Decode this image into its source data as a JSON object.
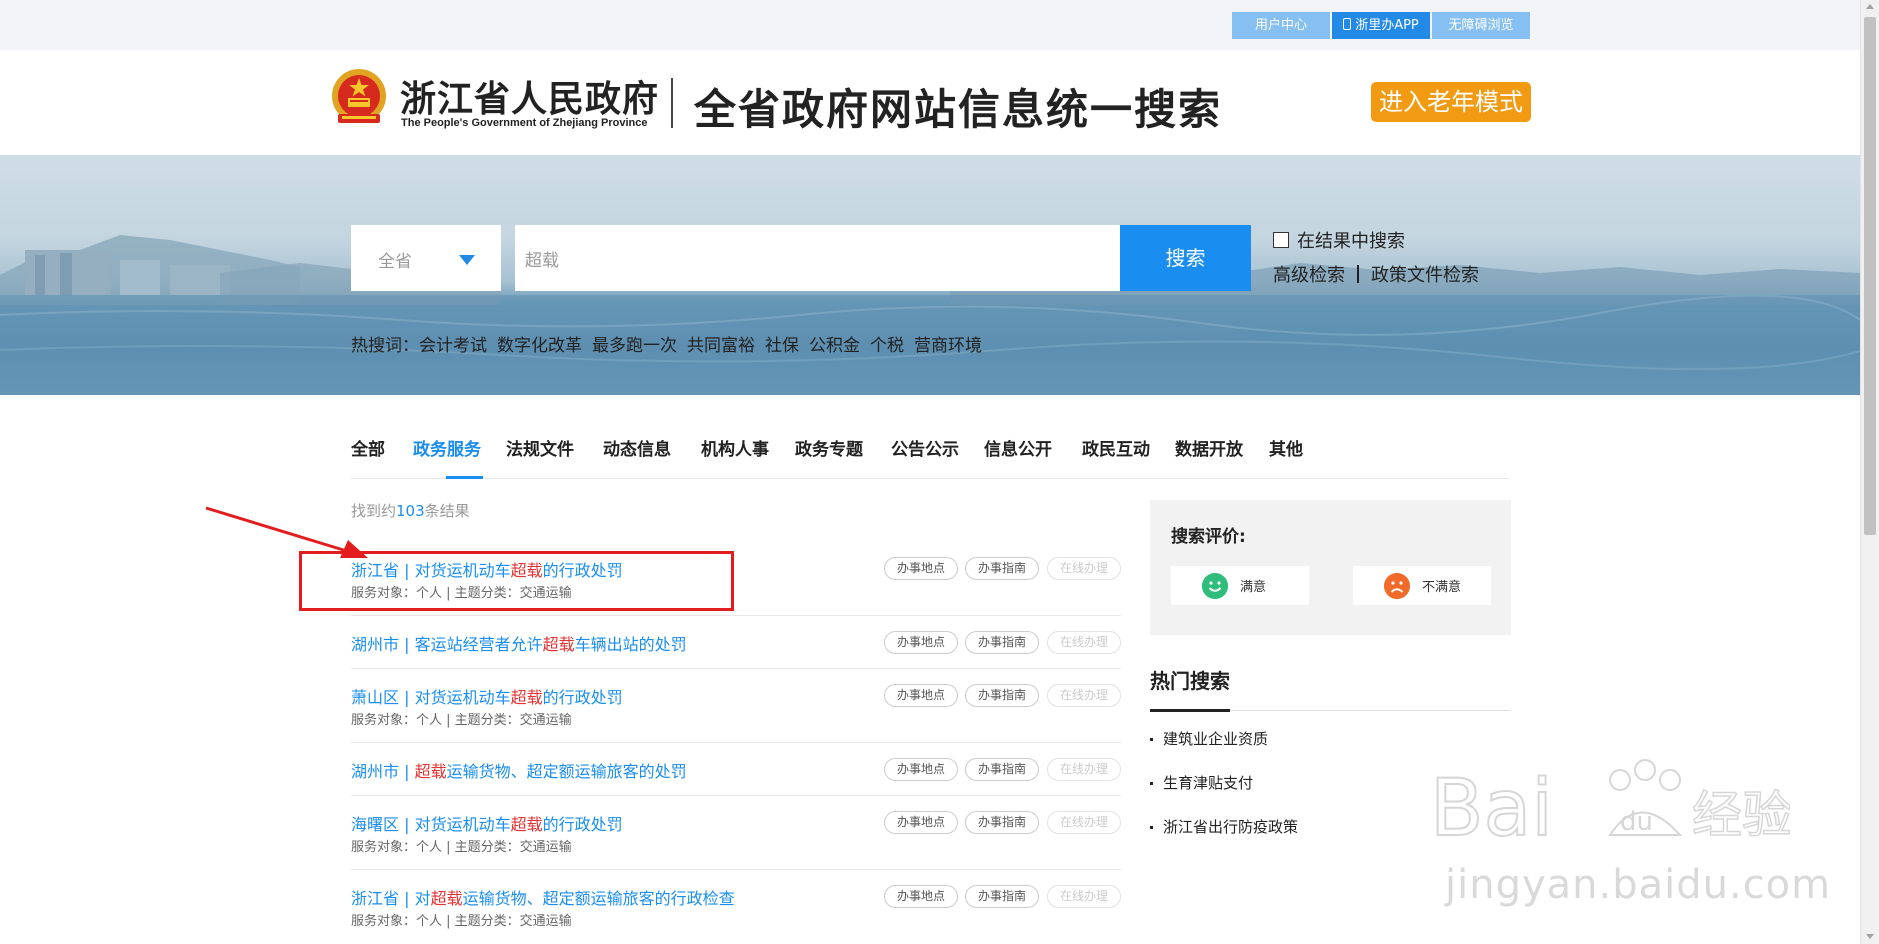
{
  "util_bar": {
    "user_center": "用户中心",
    "app": "浙里办APP",
    "accessible": "无障碍浏览"
  },
  "header": {
    "org_cn": "浙江省人民政府",
    "org_en": "The People's Government of Zhejiang Province",
    "title": "全省政府网站信息统一搜索",
    "elder_mode": "进入老年模式"
  },
  "search": {
    "scope": "全省",
    "query": "超载",
    "button": "搜索",
    "in_results": "在结果中搜索",
    "advanced": "高级检索",
    "policy": "政策文件检索",
    "hot_prefix": "热搜词：",
    "hot_words": [
      "会计考试",
      "数字化改革",
      "最多跑一次",
      "共同富裕",
      "社保",
      "公积金",
      "个税",
      "营商环境"
    ]
  },
  "tabs": [
    "全部",
    "政务服务",
    "法规文件",
    "动态信息",
    "机构人事",
    "政务专题",
    "公告公示",
    "信息公开",
    "政民互动",
    "数据开放",
    "其他"
  ],
  "results": {
    "count_prefix": "找到约",
    "count": "103",
    "count_suffix": "条结果",
    "btn_location": "办事地点",
    "btn_guide": "办事指南",
    "btn_online": "在线办理",
    "items": [
      {
        "pre": "浙江省 | 对货运机动车",
        "hl": "超载",
        "post": "的行政处罚",
        "meta": "服务对象：个人  |  主题分类：交通运输"
      },
      {
        "pre": "湖州市 | 客运站经营者允许",
        "hl": "超载",
        "post": "车辆出站的处罚",
        "meta": ""
      },
      {
        "pre": "萧山区 | 对货运机动车",
        "hl": "超载",
        "post": "的行政处罚",
        "meta": "服务对象：个人  |  主题分类：交通运输"
      },
      {
        "pre": "湖州市 | ",
        "hl": "超载",
        "post": "运输货物、超定额运输旅客的处罚",
        "meta": ""
      },
      {
        "pre": "海曙区 | 对货运机动车",
        "hl": "超载",
        "post": "的行政处罚",
        "meta": "服务对象：个人  |  主题分类：交通运输"
      },
      {
        "pre": "浙江省 | 对",
        "hl": "超载",
        "post": "运输货物、超定额运输旅客的行政检查",
        "meta": "服务对象：个人  |  主题分类：交通运输"
      }
    ]
  },
  "rating": {
    "title": "搜索评价:",
    "good": "满意",
    "bad": "不满意"
  },
  "hot_search": {
    "title": "热门搜索",
    "items": [
      "建筑业企业资质",
      "生育津贴支付",
      "浙江省出行防疫政策"
    ]
  },
  "watermark": {
    "text": "jingyan.baidu.com"
  },
  "colors": {
    "accent": "#1a8ef0",
    "highlight": "#e53333",
    "elder_button": "#f29a12",
    "annotation": "#e31d1d"
  }
}
